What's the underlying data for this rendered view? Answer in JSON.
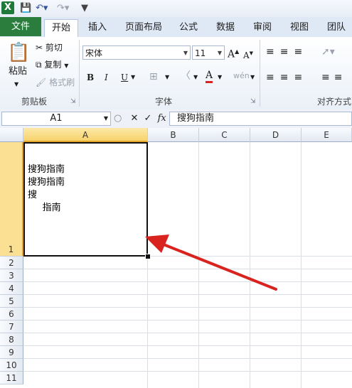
{
  "tabs": {
    "file": "文件",
    "home": "开始",
    "insert": "插入",
    "page_layout": "页面布局",
    "formulas": "公式",
    "data": "数据",
    "review": "审阅",
    "view": "视图",
    "team": "团队"
  },
  "clipboard": {
    "paste": "粘贴",
    "cut": "剪切",
    "copy": "复制",
    "format_painter": "格式刷",
    "group": "剪贴板"
  },
  "font": {
    "name": "宋体",
    "size": "11",
    "bold": "B",
    "italic": "I",
    "underline": "U",
    "color_letter": "A",
    "phonetic": "wén",
    "group": "字体"
  },
  "alignment": {
    "group": "对齐方式"
  },
  "formula_bar": {
    "name_box": "A1",
    "fx": "fx",
    "value": "搜狗指南"
  },
  "columns": [
    "A",
    "B",
    "C",
    "D",
    "E"
  ],
  "rows": [
    "1",
    "2",
    "3",
    "4",
    "5",
    "6",
    "7",
    "8",
    "9",
    "10",
    "11"
  ],
  "cell_a1": "搜狗指南\n搜狗指南\n搜\n     指南",
  "colors": {
    "file_tab": "#2b7d3e",
    "selection": "#f7d36c",
    "arrow": "#d9231f"
  }
}
